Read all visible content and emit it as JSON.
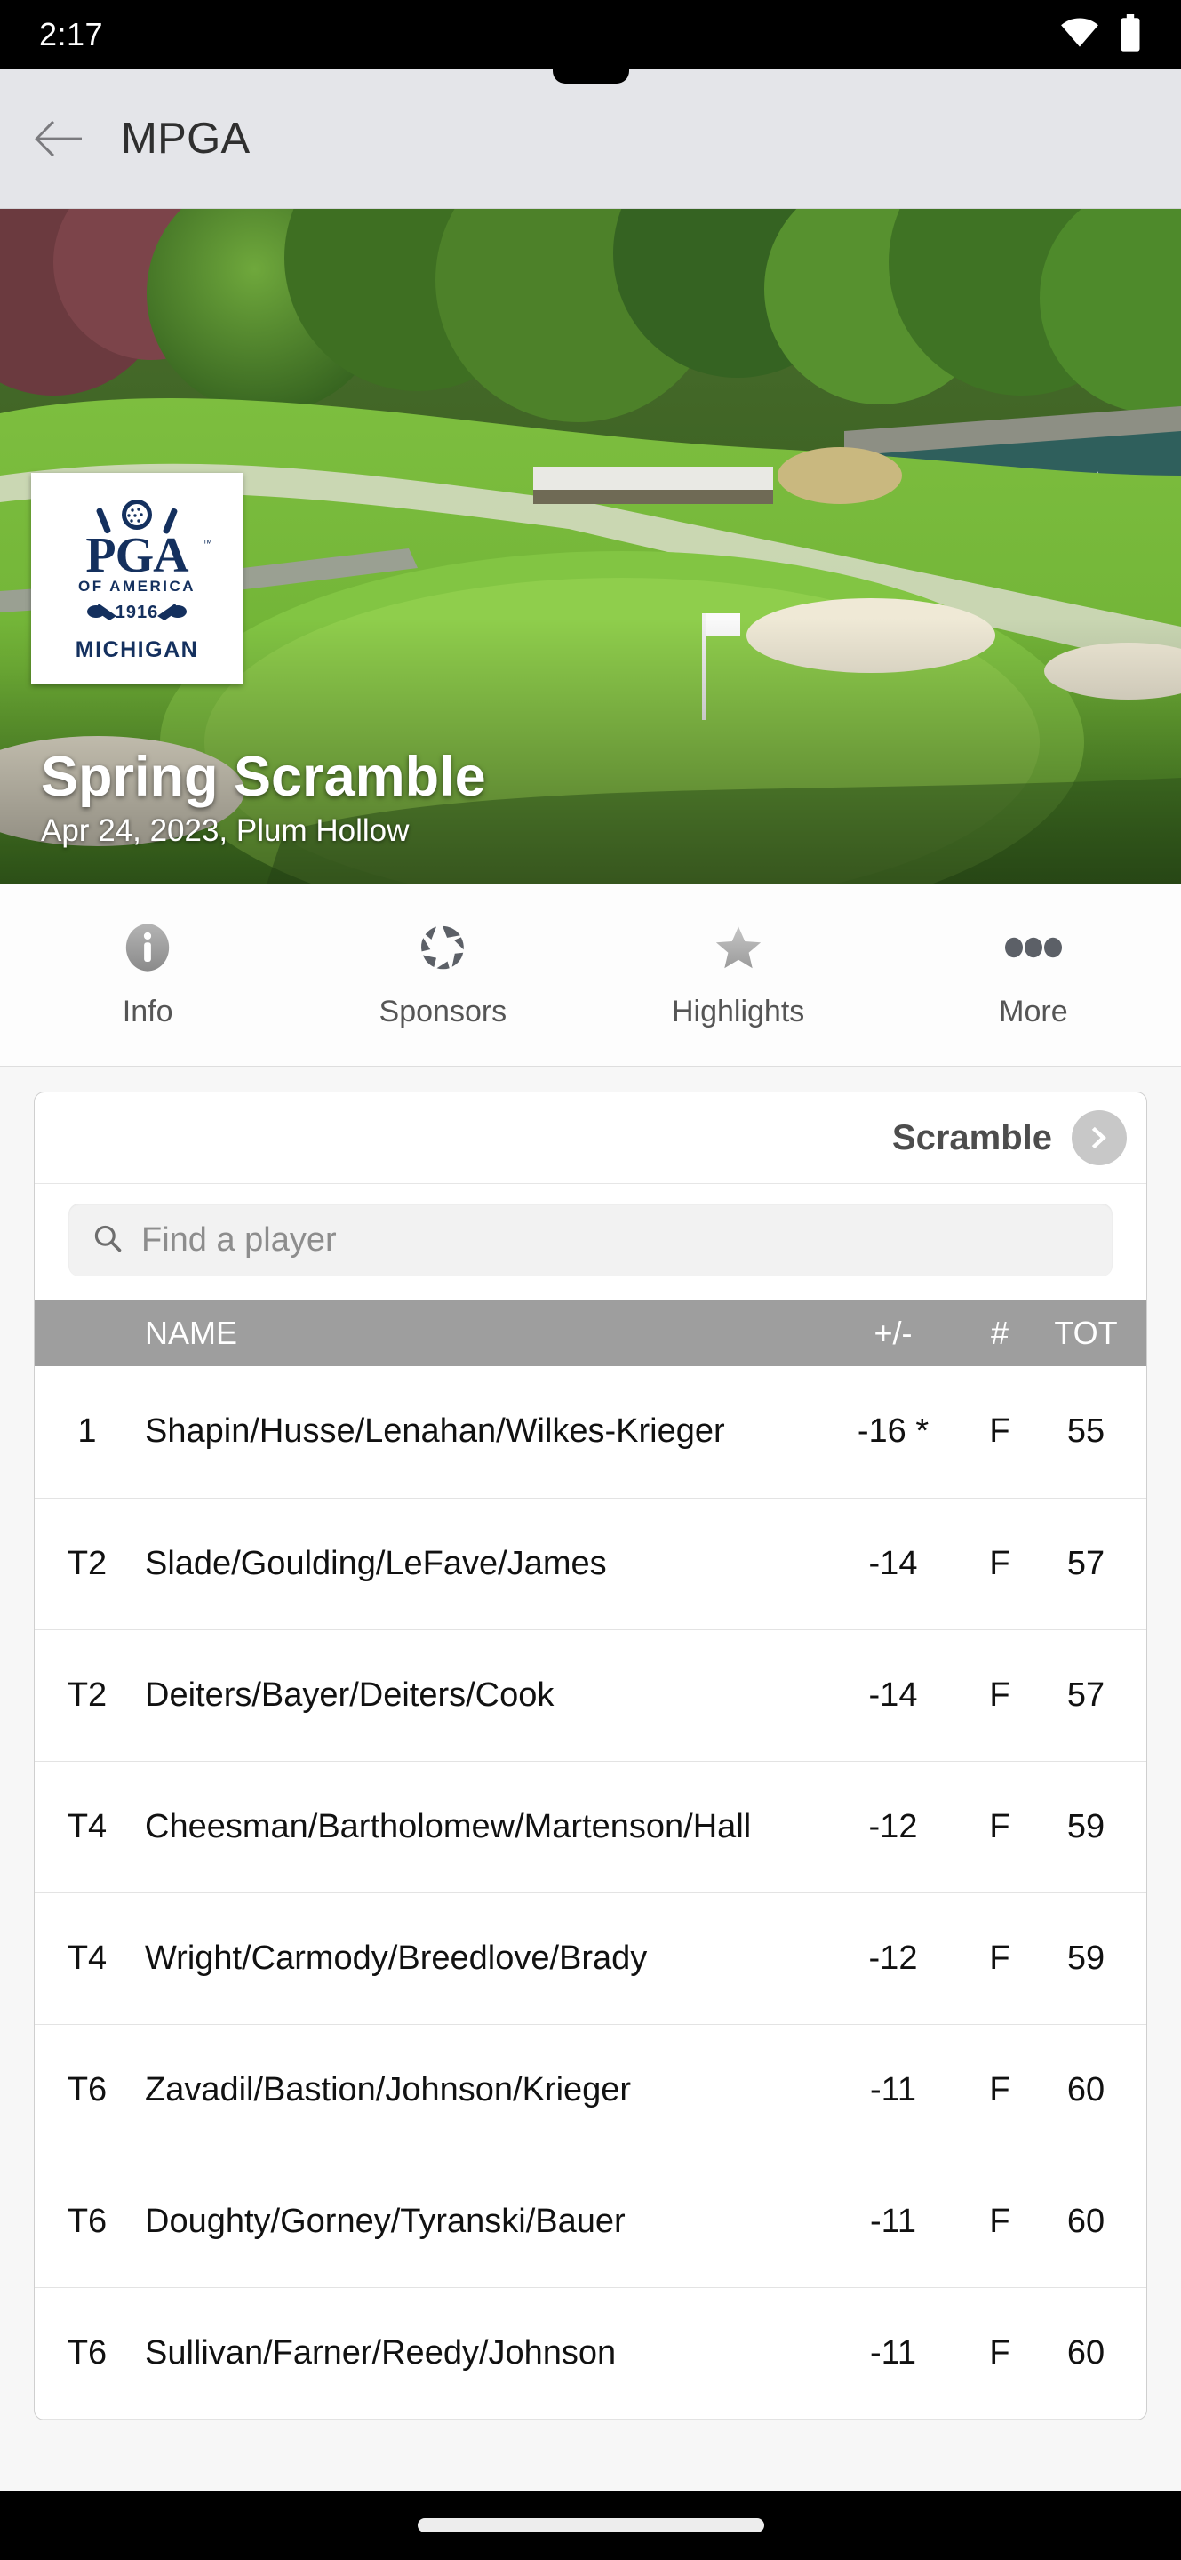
{
  "status_bar": {
    "time": "2:17",
    "icons": [
      "wifi-icon",
      "battery-icon"
    ]
  },
  "app_bar": {
    "back_icon": "back-arrow-icon",
    "title": "MPGA"
  },
  "hero": {
    "logo": {
      "brand": "PGA",
      "of_america": "OF AMERICA",
      "year": "1916",
      "section": "MICHIGAN"
    },
    "title": "Spring Scramble",
    "subtitle": "Apr 24, 2023, Plum Hollow"
  },
  "tabs": [
    {
      "label": "Info",
      "icon": "info-circle-icon"
    },
    {
      "label": "Sponsors",
      "icon": "aperture-icon"
    },
    {
      "label": "Highlights",
      "icon": "star-icon"
    },
    {
      "label": "More",
      "icon": "ellipsis-icon"
    }
  ],
  "leaderboard": {
    "format_label": "Scramble",
    "next_icon": "chevron-right-icon",
    "search": {
      "icon": "search-icon",
      "value": "",
      "placeholder": "Find a player"
    },
    "columns": [
      "",
      "NAME",
      "+/-",
      "#",
      "TOT"
    ],
    "rows": [
      {
        "rank": "1",
        "name": "Shapin/Husse/Lenahan/Wilkes-Krieger",
        "score": "-16 *",
        "hole": "F",
        "total": "55"
      },
      {
        "rank": "T2",
        "name": "Slade/Goulding/LeFave/James",
        "score": "-14",
        "hole": "F",
        "total": "57"
      },
      {
        "rank": "T2",
        "name": "Deiters/Bayer/Deiters/Cook",
        "score": "-14",
        "hole": "F",
        "total": "57"
      },
      {
        "rank": "T4",
        "name": "Cheesman/Bartholomew/Martenson/Hall",
        "score": "-12",
        "hole": "F",
        "total": "59"
      },
      {
        "rank": "T4",
        "name": "Wright/Carmody/Breedlove/Brady",
        "score": "-12",
        "hole": "F",
        "total": "59"
      },
      {
        "rank": "T6",
        "name": "Zavadil/Bastion/Johnson/Krieger",
        "score": "-11",
        "hole": "F",
        "total": "60"
      },
      {
        "rank": "T6",
        "name": "Doughty/Gorney/Tyranski/Bauer",
        "score": "-11",
        "hole": "F",
        "total": "60"
      },
      {
        "rank": "T6",
        "name": "Sullivan/Farner/Reedy/Johnson",
        "score": "-11",
        "hole": "F",
        "total": "60"
      }
    ]
  },
  "colors": {
    "score_negative": "#c00000",
    "header_row": "#9e9e9e",
    "app_bar": "#e4e5e9",
    "logo_navy": "#14305e"
  },
  "nav_bar": {
    "home_indicator": "home-indicator"
  }
}
